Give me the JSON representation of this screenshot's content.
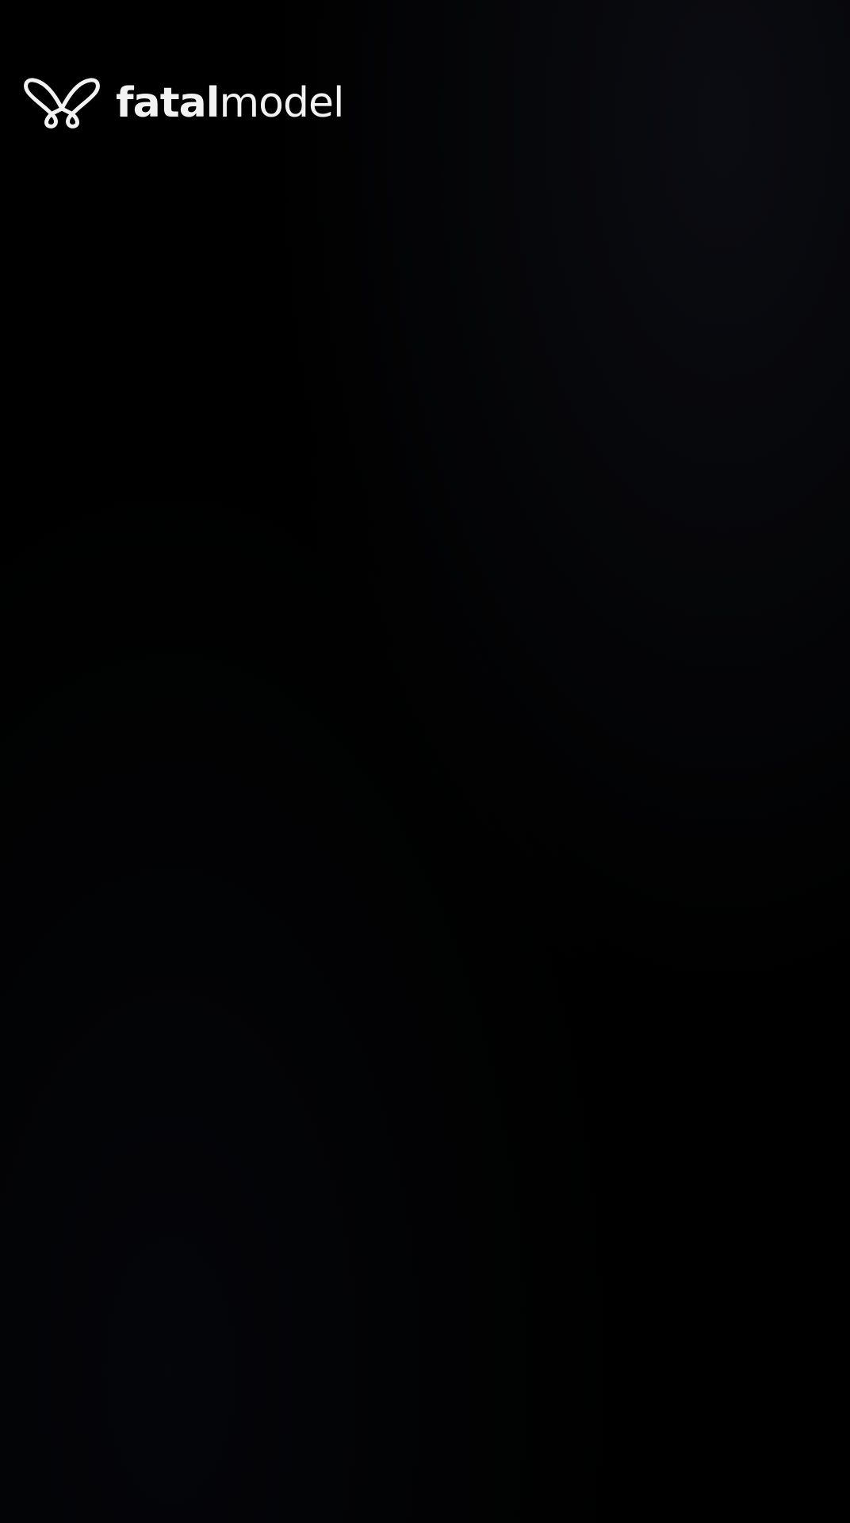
{
  "brand": {
    "name_bold": "fatal",
    "name_light": "model",
    "logo_icon": "butterfly-icon",
    "text_color": "#f2f2f2"
  },
  "screen": {
    "background_color": "#000000"
  }
}
